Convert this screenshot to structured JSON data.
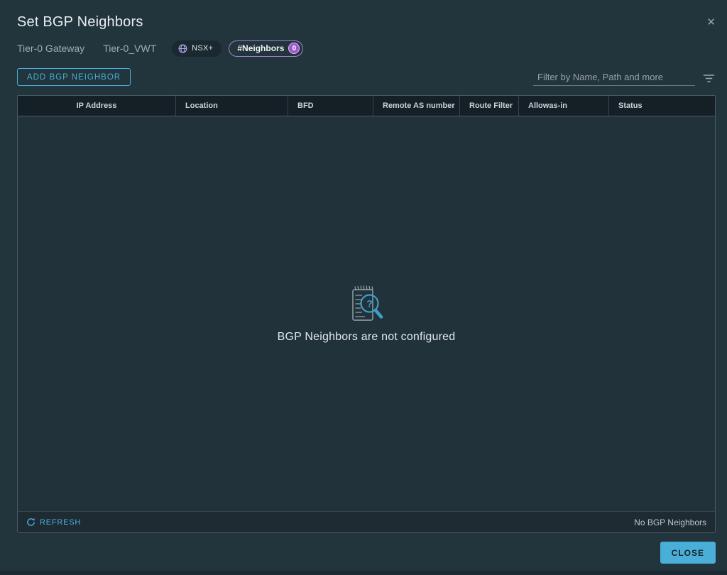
{
  "dialog": {
    "title": "Set BGP Neighbors",
    "close_glyph": "✕"
  },
  "subheader": {
    "gateway_type": "Tier-0 Gateway",
    "gateway_name": "Tier-0_VWT",
    "nsx_badge_label": "NSX+",
    "neighbors_pill": {
      "label": "#Neighbors",
      "count": "0"
    }
  },
  "toolbar": {
    "add_button_label": "ADD BGP NEIGHBOR",
    "filter_placeholder": "Filter by Name, Path and more"
  },
  "table": {
    "columns": [
      "IP Address",
      "Location",
      "BFD",
      "Remote AS number",
      "Route Filter",
      "Allowas-in",
      "Status"
    ],
    "rows": [],
    "empty_message": "BGP Neighbors are not configured"
  },
  "footer": {
    "refresh_label": "REFRESH",
    "count_label": "No BGP Neighbors"
  },
  "actions": {
    "close_button_label": "CLOSE"
  },
  "colors": {
    "accent_teal": "#49afd9",
    "badge_purple": "#9c57cd",
    "dialog_background": "#22343c",
    "grid_header_background": "#151f26"
  }
}
